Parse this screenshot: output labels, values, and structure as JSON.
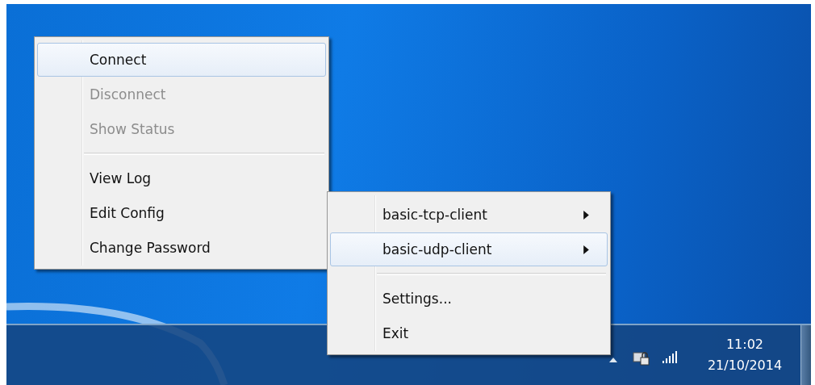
{
  "main_menu": {
    "items": [
      {
        "kind": "item",
        "label": "Connect",
        "disabled": false,
        "selected": true,
        "has_submenu": false
      },
      {
        "kind": "item",
        "label": "Disconnect",
        "disabled": true,
        "selected": false,
        "has_submenu": false
      },
      {
        "kind": "item",
        "label": "Show Status",
        "disabled": true,
        "selected": false,
        "has_submenu": false
      },
      {
        "kind": "separator"
      },
      {
        "kind": "item",
        "label": "View Log",
        "disabled": false,
        "selected": false,
        "has_submenu": false
      },
      {
        "kind": "item",
        "label": "Edit Config",
        "disabled": false,
        "selected": false,
        "has_submenu": false
      },
      {
        "kind": "item",
        "label": "Change Password",
        "disabled": false,
        "selected": false,
        "has_submenu": false
      }
    ]
  },
  "tray_menu": {
    "items": [
      {
        "kind": "item",
        "label": "basic-tcp-client",
        "disabled": false,
        "selected": false,
        "has_submenu": true
      },
      {
        "kind": "item",
        "label": "basic-udp-client",
        "disabled": false,
        "selected": true,
        "has_submenu": true
      },
      {
        "kind": "separator"
      },
      {
        "kind": "item",
        "label": "Settings...",
        "disabled": false,
        "selected": false,
        "has_submenu": false
      },
      {
        "kind": "item",
        "label": "Exit",
        "disabled": false,
        "selected": false,
        "has_submenu": false
      }
    ]
  },
  "taskbar": {
    "clock": {
      "time": "11:02",
      "date": "21/10/2014"
    }
  }
}
